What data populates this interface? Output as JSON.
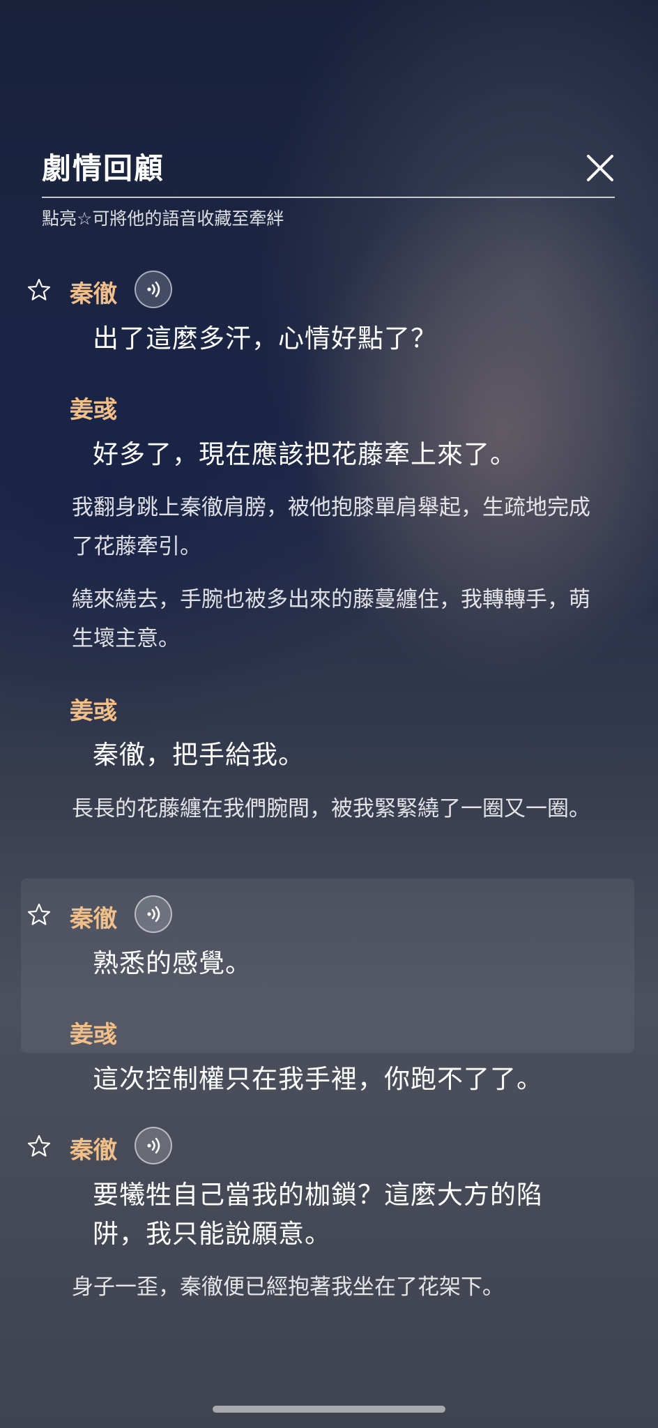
{
  "header": {
    "title": "劇情回顧",
    "subtitle": "點亮☆可將他的語音收藏至牽絆"
  },
  "entries": [
    {
      "speaker": "秦徹",
      "line": "出了這麼多汗，心情好點了？"
    },
    {
      "speaker": "姜彧",
      "line": "好多了，現在應該把花藤牽上來了。"
    },
    {
      "narration": "我翻身跳上秦徹肩膀，被他抱膝單肩舉起，生疏地完成了花藤牽引。"
    },
    {
      "narration": "繞來繞去，手腕也被多出來的藤蔓纏住，我轉轉手，萌生壞主意。"
    },
    {
      "speaker": "姜彧",
      "line": "秦徹，把手給我。"
    },
    {
      "narration": "長長的花藤纏在我們腕間，被我緊緊繞了一圈又一圈。"
    },
    {
      "speaker": "秦徹",
      "line": "熟悉的感覺。"
    },
    {
      "speaker": "姜彧",
      "line": "這次控制權只在我手裡，你跑不了了。"
    },
    {
      "speaker": "秦徹",
      "line": "要犧牲自己當我的枷鎖？這麼大方的陷阱，我只能說願意。"
    },
    {
      "narration": "身子一歪，秦徹便已經抱著我坐在了花架下。"
    }
  ],
  "colors": {
    "speaker": "#f1bf8a",
    "text": "#ffffff"
  },
  "icons": {
    "close": "close-icon",
    "star": "star-outline-icon",
    "voice": "voice-play-icon"
  }
}
